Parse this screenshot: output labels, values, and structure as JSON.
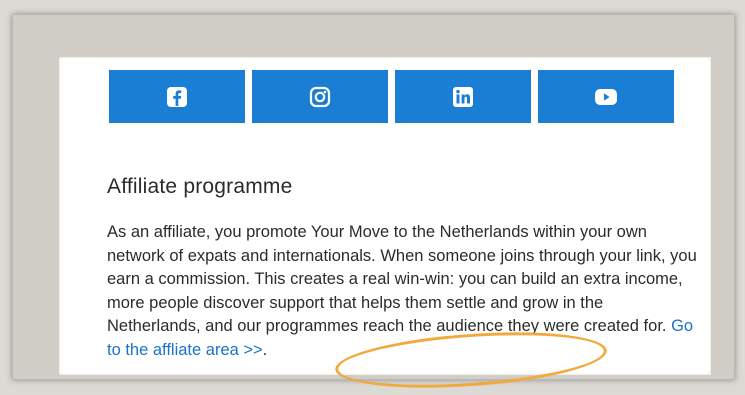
{
  "social": {
    "buttons": [
      {
        "icon": "facebook-icon"
      },
      {
        "icon": "instagram-icon"
      },
      {
        "icon": "linkedin-icon"
      },
      {
        "icon": "youtube-icon"
      }
    ],
    "color": "#1a7fd4"
  },
  "affiliate": {
    "heading": "Affiliate programme",
    "body": "As an affiliate, you promote Your Move to the Netherlands within your own network of expats and internationals. When someone joins through your link, you earn a commission. This creates a real win-win: you can build an extra income, more people discover support that helps them settle and grow in the Netherlands, and our programmes reach the audience they were created for.",
    "link_text": "Go to the affliate area >>",
    "after_link": "."
  },
  "highlight_color": "#f2a83a"
}
